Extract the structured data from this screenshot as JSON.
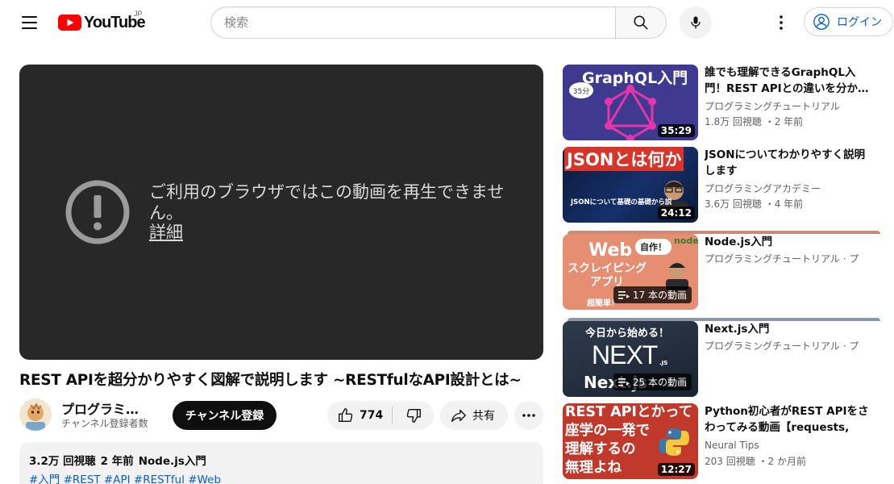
{
  "header": {
    "logo_text": "YouTube",
    "region": "JP",
    "search_placeholder": "検索",
    "login_label": "ログイン"
  },
  "player": {
    "error_message": "ご利用のブラウザではこの動画を再生できません。",
    "details_link": "詳細"
  },
  "video": {
    "title": "REST APIを超分かりやすく図解で説明します ~RESTfulなAPI設計とは~",
    "channel_name": "プログラミングチュートリアル",
    "channel_subscribers": "チャンネル登録者数",
    "subscribe_label": "チャンネル登録",
    "like_count": "774",
    "share_label": "共有"
  },
  "description": {
    "views": "3.2万 回視聴",
    "age": "2 年前",
    "playlist": "Node.js入門",
    "hashtags": "#入門 #REST #API #RESTful #Web"
  },
  "recommendations": [
    {
      "title": "誰でも理解できるGraphQL入門！REST APIとの違いを分か…",
      "channel": "プログラミングチュートリアル",
      "stats": "1.8万 回視聴 ・2 年前",
      "duration": "35:29",
      "thumb_text": "GraphQL入門",
      "thumb_badge": "35分"
    },
    {
      "title": "JSONについてわかりやすく説明します",
      "channel": "プログラミングアカデミー",
      "stats": "3.6万 回視聴 ・4 年前",
      "duration": "24:12",
      "thumb_text": "JSONとは何か",
      "thumb_caption": "JSONについて基礎の基礎から説"
    },
    {
      "title": "Node.js入門",
      "channel": "プログラミングチュートリアル · プ",
      "playlist_count": "17 本の動画",
      "thumb_text": "Web",
      "thumb_sub": "スクレイピング",
      "thumb_sub2": "アプリ",
      "thumb_bubble": "自作！",
      "thumb_corner": "node",
      "thumb_foot": "超簡単！"
    },
    {
      "title": "Next.js入門",
      "channel": "プログラミングチュートリアル · プ",
      "playlist_count": "25 本の動画",
      "thumb_text": "今日から始める！",
      "thumb_big": "NEXT",
      "thumb_js": ".JS",
      "thumb_foot": "Next.js"
    },
    {
      "title": "Python初心者がREST APIをさわってみる動画【requests, get,…",
      "channel": "Neural Tips",
      "stats": "203 回視聴 ・2 か月前",
      "duration": "12:27",
      "thumb_lines": [
        "REST APIとかって",
        "座学の一発で",
        "理解するの",
        "無理よね"
      ]
    }
  ],
  "colors": {
    "brand_red": "#ff0000",
    "link_blue": "#065fd4",
    "player_bg": "#282828"
  }
}
